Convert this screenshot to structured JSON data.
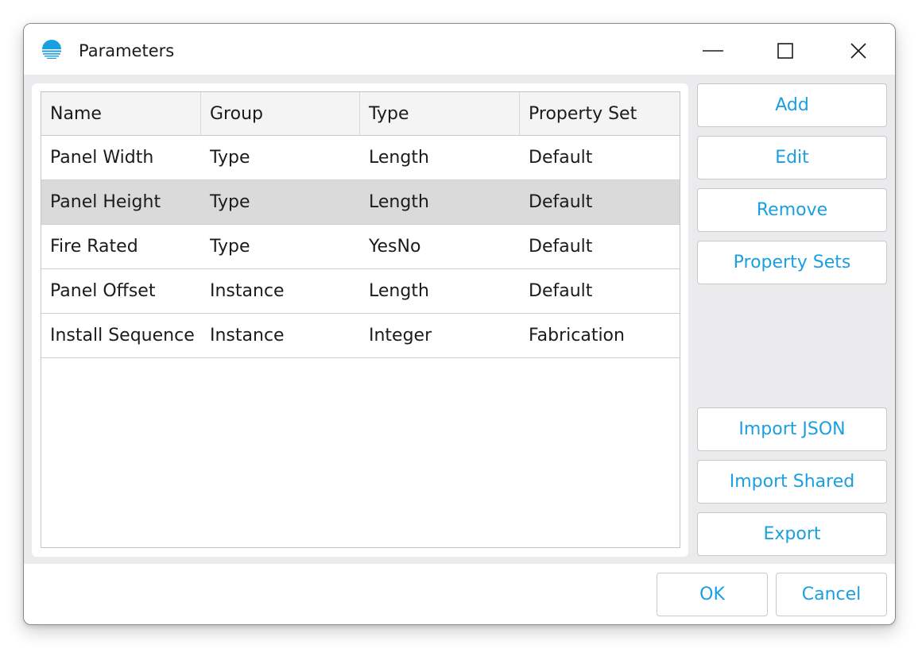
{
  "window": {
    "title": "Parameters",
    "controls": [
      "minimize-icon",
      "maximize-icon",
      "close-icon"
    ],
    "accent_color": "#1a9fe0"
  },
  "table": {
    "columns": [
      "Name",
      "Group",
      "Type",
      "Property Set"
    ],
    "rows": [
      {
        "name": "Panel Width",
        "group": "Type",
        "type": "Length",
        "property_set": "Default",
        "selected": false
      },
      {
        "name": "Panel Height",
        "group": "Type",
        "type": "Length",
        "property_set": "Default",
        "selected": true
      },
      {
        "name": "Fire Rated",
        "group": "Type",
        "type": "YesNo",
        "property_set": "Default",
        "selected": false
      },
      {
        "name": "Panel Offset",
        "group": "Instance",
        "type": "Length",
        "property_set": "Default",
        "selected": false
      },
      {
        "name": "Install Sequence",
        "group": "Instance",
        "type": "Integer",
        "property_set": "Fabrication",
        "selected": false
      }
    ]
  },
  "side_buttons": {
    "top": [
      "Add",
      "Edit",
      "Remove",
      "Property Sets"
    ],
    "bottom": [
      "Import JSON",
      "Import Shared",
      "Export"
    ]
  },
  "footer": {
    "ok_label": "OK",
    "cancel_label": "Cancel"
  }
}
